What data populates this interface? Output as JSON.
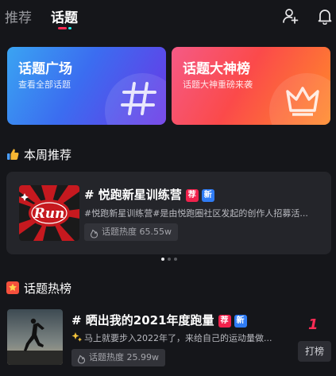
{
  "header": {
    "tabs": [
      {
        "label": "推荐",
        "active": false
      },
      {
        "label": "话题",
        "active": true
      }
    ],
    "icons": [
      "add-user-icon",
      "bell-icon"
    ],
    "indicator_colors": [
      "#fe2c55",
      "#25f4ee"
    ]
  },
  "cards": [
    {
      "title": "话题广场",
      "subtitle": "查看全部话题",
      "icon": "hashtag-icon",
      "gradient": [
        "#3aa4f2",
        "#6a37e6"
      ]
    },
    {
      "title": "话题大神榜",
      "subtitle": "话题大神重磅来袭",
      "icon": "crown-icon",
      "gradient": [
        "#f55a86",
        "#ff8a2a"
      ]
    }
  ],
  "weekly": {
    "section_title": "本周推荐",
    "section_icon": "thumbs-up-icon",
    "item": {
      "title": "# 悦跑新星训练营",
      "badges": [
        "荐",
        "新"
      ],
      "description": "#悦跑新星训练营#是由悦跑圈社区发起的创作人招募活...",
      "heat": "话题热度 65.55w",
      "cover_text": "Run"
    },
    "carousel": {
      "total": 3,
      "active_index": 0
    }
  },
  "hot": {
    "section_title": "话题热榜",
    "section_icon": "star-icon",
    "items": [
      {
        "title": "# 晒出我的2021年度跑量",
        "badges": [
          "荐",
          "新"
        ],
        "description": "马上就要步入2022年了，来给自己的运动量做...",
        "heat": "话题热度 25.99w",
        "rank": "1",
        "action": "打榜"
      }
    ]
  },
  "colors": {
    "accent": "#fe2c55",
    "badge_recommend": "#f1224c",
    "badge_new": "#2f7cf5",
    "background": "#15161a",
    "card": "#24252a"
  }
}
